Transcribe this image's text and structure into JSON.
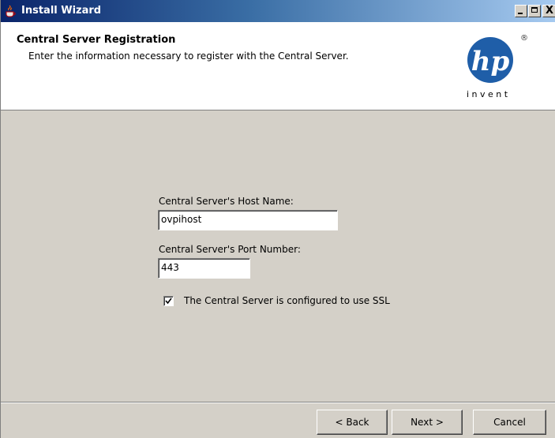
{
  "window": {
    "title": "Install Wizard",
    "icon": "java-cup-icon",
    "controls": {
      "minimize": "minimize-icon",
      "maximize": "maximize-icon",
      "close": "X"
    }
  },
  "header": {
    "title": "Central Server Registration",
    "subtitle": "Enter the information necessary to register with the Central Server.",
    "logo": {
      "mark": "hp",
      "tagline": "i n v e n t",
      "registered": "®",
      "color": "#1f5ea8"
    }
  },
  "form": {
    "host": {
      "label": "Central Server's Host Name:",
      "value": "ovpihost"
    },
    "port": {
      "label": "Central Server's Port Number:",
      "value": "443"
    },
    "ssl": {
      "label": "The Central Server is configured to use SSL",
      "checked": true
    }
  },
  "buttons": {
    "back": "< Back",
    "next": "Next >",
    "cancel": "Cancel"
  }
}
